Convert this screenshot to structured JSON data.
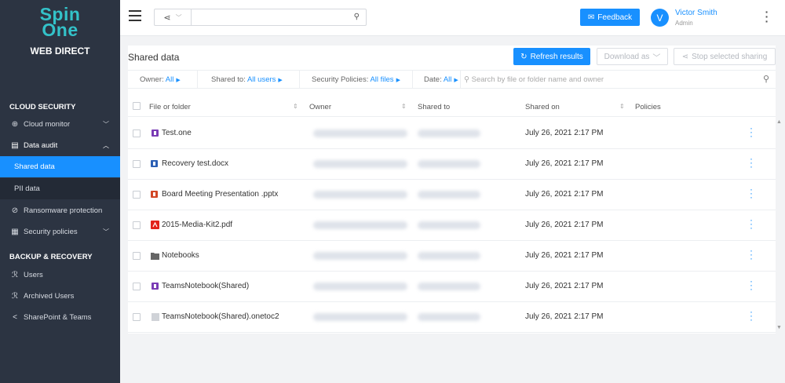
{
  "sidebar": {
    "logo_line1": "Spin",
    "logo_line2": "One",
    "logo_sub": "WEB DIRECT",
    "sections": [
      {
        "label": "CLOUD SECURITY"
      },
      {
        "label": "BACKUP & RECOVERY"
      }
    ],
    "items": [
      {
        "label": "Cloud monitor",
        "icon": "globe-icon"
      },
      {
        "label": "Data audit",
        "icon": "document-icon"
      },
      {
        "label": "Shared data"
      },
      {
        "label": "PII data"
      },
      {
        "label": "Ransomware protection",
        "icon": "shield-icon"
      },
      {
        "label": "Security policies",
        "icon": "policy-icon"
      },
      {
        "label": "Users",
        "icon": "users-icon"
      },
      {
        "label": "Archived Users",
        "icon": "archived-users-icon"
      },
      {
        "label": "SharePoint & Teams",
        "icon": "share-icon"
      }
    ]
  },
  "topbar": {
    "search_placeholder": "",
    "feedback_label": "Feedback",
    "avatar_initial": "V",
    "user_name": "Victor Smith",
    "user_role": "Admin"
  },
  "panel": {
    "title": "Shared data",
    "refresh_label": "Refresh results",
    "download_label": "Download as",
    "stop_label": "Stop selected sharing"
  },
  "filters": {
    "owner_label": "Owner:",
    "owner_value": "All",
    "shared_to_label": "Shared to:",
    "shared_to_value": "All users",
    "policies_label": "Security Policies:",
    "policies_value": "All files",
    "date_label": "Date:",
    "date_value": "All",
    "search_placeholder": "Search by file or folder name and owner"
  },
  "table": {
    "columns": [
      "File or folder",
      "Owner",
      "Shared to",
      "Shared on",
      "Policies"
    ],
    "rows": [
      {
        "name": "Test.one",
        "icon": "onenote-icon",
        "icon_color": "#7a3cb5",
        "shared_on": "July 26, 2021 2:17 PM"
      },
      {
        "name": "Recovery test.docx",
        "icon": "word-icon",
        "icon_color": "#2b5fb4",
        "shared_on": "July 26, 2021 2:17 PM"
      },
      {
        "name": "Board Meeting Presentation .pptx",
        "icon": "powerpoint-icon",
        "icon_color": "#d24726",
        "shared_on": "July 26, 2021 2:17 PM"
      },
      {
        "name": "2015-Media-Kit2.pdf",
        "icon": "pdf-icon",
        "icon_color": "#e2231a",
        "shared_on": "July 26, 2021 2:17 PM"
      },
      {
        "name": "Notebooks",
        "icon": "folder-icon",
        "icon_color": "#666666",
        "shared_on": "July 26, 2021 2:17 PM"
      },
      {
        "name": "TeamsNotebook(Shared)",
        "icon": "onenote-icon",
        "icon_color": "#7a3cb5",
        "shared_on": "July 26, 2021 2:17 PM"
      },
      {
        "name": "TeamsNotebook(Shared).onetoc2",
        "icon": "file-icon",
        "icon_color": "#d0d3d8",
        "shared_on": "July 26, 2021 2:17 PM"
      }
    ]
  },
  "colors": {
    "accent": "#1890ff",
    "sidebar_bg": "#2c3442",
    "logo": "#33c2c9"
  }
}
